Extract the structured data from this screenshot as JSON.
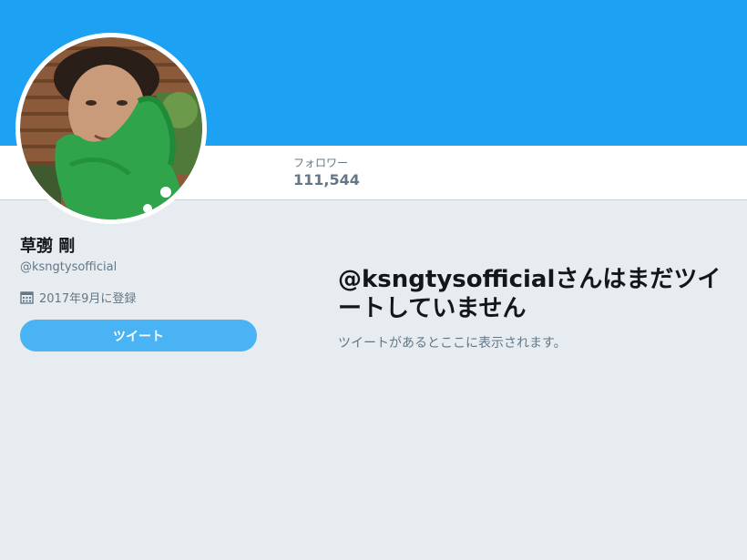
{
  "banner": {
    "color": "#1da1f2"
  },
  "navbar": {
    "stats": [
      {
        "label": "フォロワー",
        "value": "111,544"
      }
    ]
  },
  "profile": {
    "name": "草彅 剛",
    "handle": "@ksngtysofficial",
    "joined": "2017年9月に登録",
    "joined_icon": "calendar-icon",
    "tweet_button_label": "ツイート"
  },
  "timeline": {
    "empty_title": "@ksngtysofficialさんはまだツイートしていません",
    "empty_subtitle": "ツイートがあるとここに表示されます。"
  },
  "colors": {
    "accent": "#1da1f2",
    "button": "#4ab3f4",
    "background": "#e6ecf0",
    "muted_text": "#657786",
    "primary_text": "#14171a"
  }
}
